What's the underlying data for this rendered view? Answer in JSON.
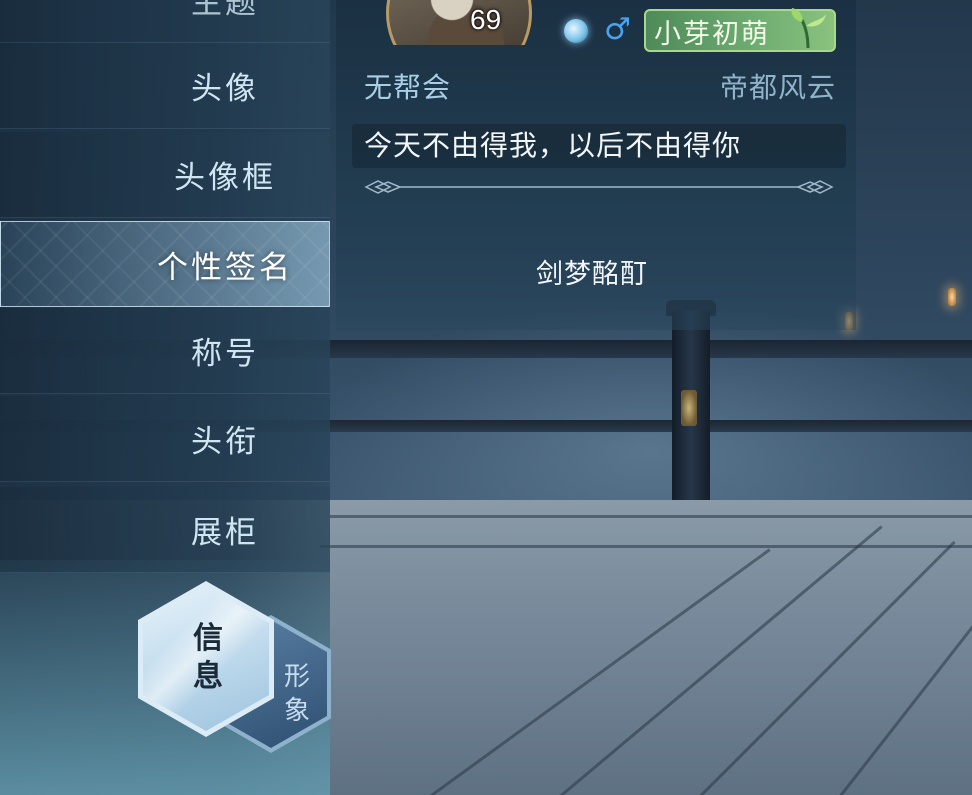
{
  "menu": {
    "items": [
      {
        "label": "主题"
      },
      {
        "label": "头像"
      },
      {
        "label": "头像框"
      },
      {
        "label": "个性签名"
      },
      {
        "label": "称号"
      },
      {
        "label": "头衔"
      },
      {
        "label": "展柜"
      }
    ],
    "active_item": "个性签名"
  },
  "tabs": {
    "info": "信息",
    "appearance": "形象"
  },
  "profile": {
    "level": "69",
    "gender_icon": "male-icon",
    "badge": "小芽初萌",
    "guild": "无帮会",
    "server": "帝都风云",
    "signature": "今天不由得我，以后不由得你",
    "title": "剑梦酩酊"
  },
  "colors": {
    "badge_green": "#6fae72",
    "male_blue": "#4aa3f0",
    "active_border": "#dcecf6"
  }
}
